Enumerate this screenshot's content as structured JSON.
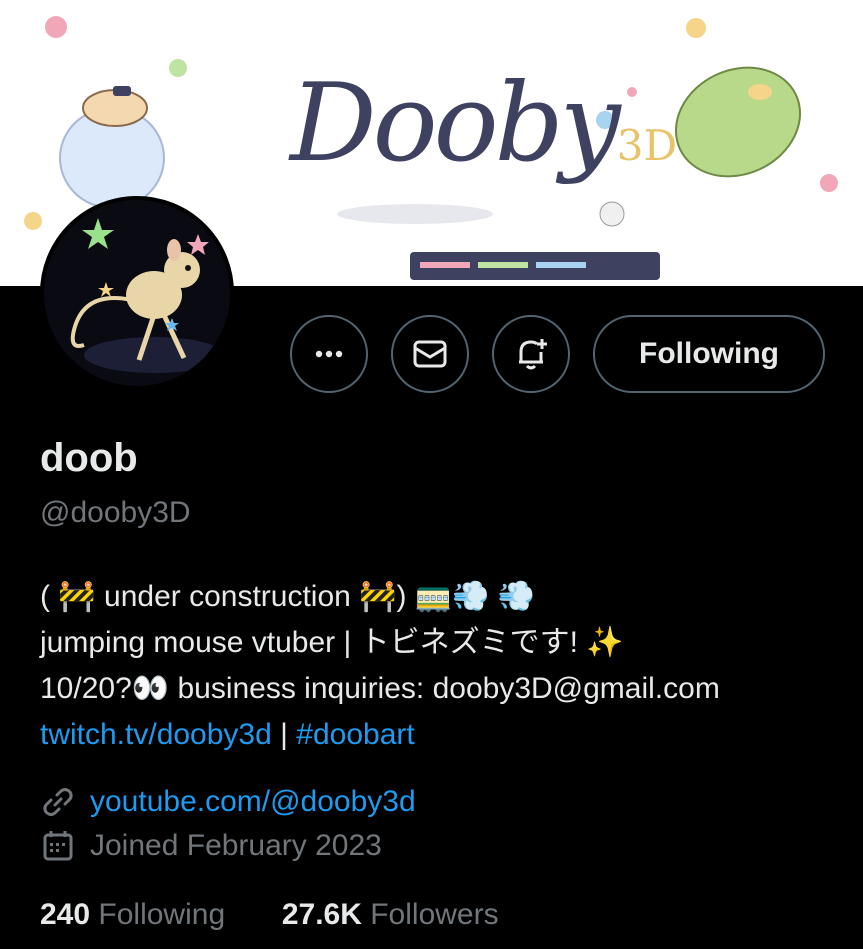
{
  "banner": {
    "title": "Dooby",
    "title_suffix": "3D"
  },
  "actions": {
    "more_icon": "more-horizontal-icon",
    "message_icon": "envelope-icon",
    "notify_icon": "bell-plus-icon",
    "follow_label": "Following"
  },
  "profile": {
    "name": "doob",
    "handle": "@dooby3D",
    "bio": {
      "line1": "( 🚧 under construction 🚧) 🚃💨 💨",
      "line2": " jumping mouse vtuber | トビネズミです! ✨",
      "line3": "10/20?👀 business inquiries: dooby3D@gmail.com",
      "link_twitch": "twitch.tv/dooby3d",
      "separator": " | ",
      "link_hashtag": "#doobart"
    },
    "website": "youtube.com/@dooby3d",
    "joined": "Joined February 2023",
    "following_count": "240",
    "following_label": "Following",
    "followers_count": "27.6K",
    "followers_label": "Followers"
  },
  "colors": {
    "accent": "#1d9bf0",
    "muted": "#71767b",
    "text": "#e7e9ea",
    "background": "#000000"
  }
}
